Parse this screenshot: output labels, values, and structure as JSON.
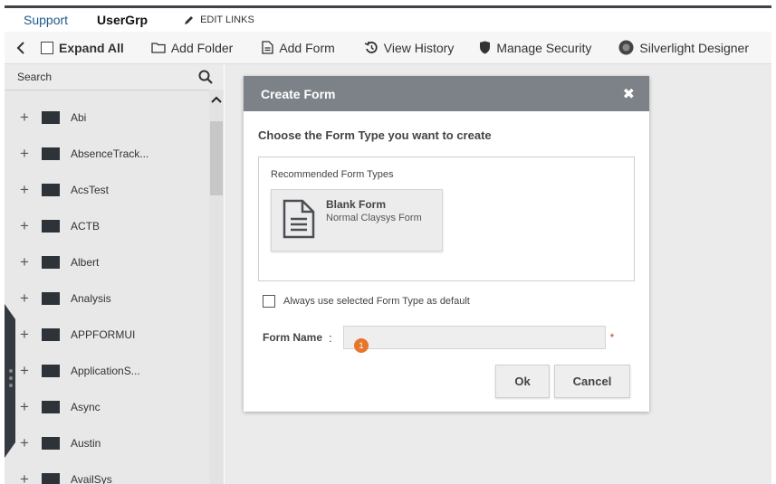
{
  "topbar": {
    "tabs": [
      "Support",
      "UserGrp"
    ],
    "edit_links": "EDIT LINKS"
  },
  "toolbar": {
    "expand_all": "Expand All",
    "add_folder": "Add Folder",
    "add_form": "Add Form",
    "view_history": "View History",
    "manage_security": "Manage Security",
    "silverlight_designer": "Silverlight Designer"
  },
  "sidebar": {
    "search_label": "Search",
    "items": [
      "Abi",
      "AbsenceTrack...",
      "AcsTest",
      "ACTB",
      "Albert",
      "Analysis",
      "APPFORMUI",
      "ApplicationS...",
      "Async",
      "Austin",
      "AvailSys"
    ]
  },
  "dialog": {
    "title": "Create Form",
    "close_glyph": "✖",
    "prompt": "Choose the Form Type you want to create",
    "recommended_heading": "Recommended Form Types",
    "form_type": {
      "name": "Blank Form",
      "description": "Normal Claysys Form"
    },
    "default_checkbox_label": "Always use selected Form Type as default",
    "form_name_label": "Form Name",
    "form_name_colon": ":",
    "form_name_value": "",
    "required_marker": "*",
    "badge": "1",
    "ok_label": "Ok",
    "cancel_label": "Cancel"
  },
  "colors": {
    "dialog_header": "#7d8288",
    "folder": "#2d3339",
    "badge": "#e6762b",
    "required": "#d2382b",
    "support_tab": "#1e5a8a"
  }
}
